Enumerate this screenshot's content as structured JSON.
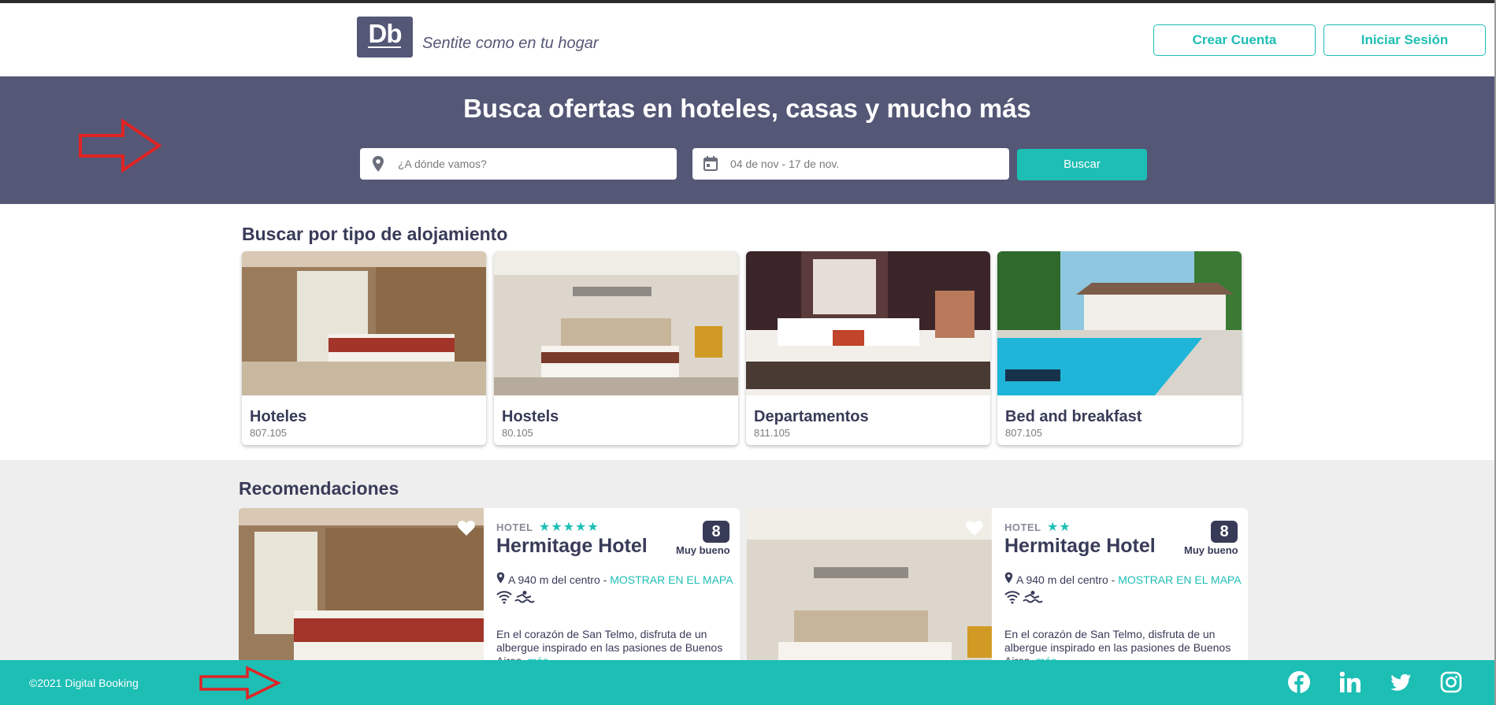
{
  "header": {
    "logo_text": "Db",
    "tagline": "Sentite como en tu hogar",
    "create_account": "Crear Cuenta",
    "login": "Iniciar Sesión"
  },
  "hero": {
    "title": "Busca ofertas en hoteles, casas y mucho más",
    "destination_placeholder": "¿A dónde vamos?",
    "dates_value": "04 de nov - 17 de nov.",
    "search_button": "Buscar"
  },
  "types": {
    "title": "Buscar por tipo de alojamiento",
    "items": [
      {
        "name": "Hoteles",
        "count": "807.105"
      },
      {
        "name": "Hostels",
        "count": "80.105"
      },
      {
        "name": "Departamentos",
        "count": "811.105"
      },
      {
        "name": "Bed and breakfast",
        "count": "807.105"
      }
    ]
  },
  "recommendations": {
    "title": "Recomendaciones",
    "items": [
      {
        "category": "HOTEL",
        "stars": "★★★★★",
        "name": "Hermitage Hotel",
        "score": "8",
        "score_label": "Muy bueno",
        "distance": "A 940 m del centro - ",
        "map_link": "MOSTRAR EN EL MAPA",
        "description": "En el corazón de San Telmo, disfruta de un albergue inspirado en las pasiones de Buenos Aires.",
        "more": "más...",
        "amenities": [
          "wifi-icon",
          "pool-icon"
        ]
      },
      {
        "category": "HOTEL",
        "stars": "★★",
        "name": "Hermitage Hotel",
        "score": "8",
        "score_label": "Muy bueno",
        "distance": "A 940 m del centro - ",
        "map_link": "MOSTRAR EN EL MAPA",
        "description": "En el corazón de San Telmo, disfruta de un albergue inspirado en las pasiones de Buenos Aires.",
        "more": "más...",
        "amenities": [
          "wifi-icon",
          "pool-icon"
        ]
      }
    ]
  },
  "footer": {
    "copyright": "©2021 Digital Booking",
    "social": [
      "facebook-icon",
      "linkedin-icon",
      "twitter-icon",
      "instagram-icon"
    ]
  },
  "colors": {
    "primary": "#545776",
    "accent": "#1dbeb4",
    "text": "#383b58",
    "annotation_arrow": "#e02424"
  }
}
